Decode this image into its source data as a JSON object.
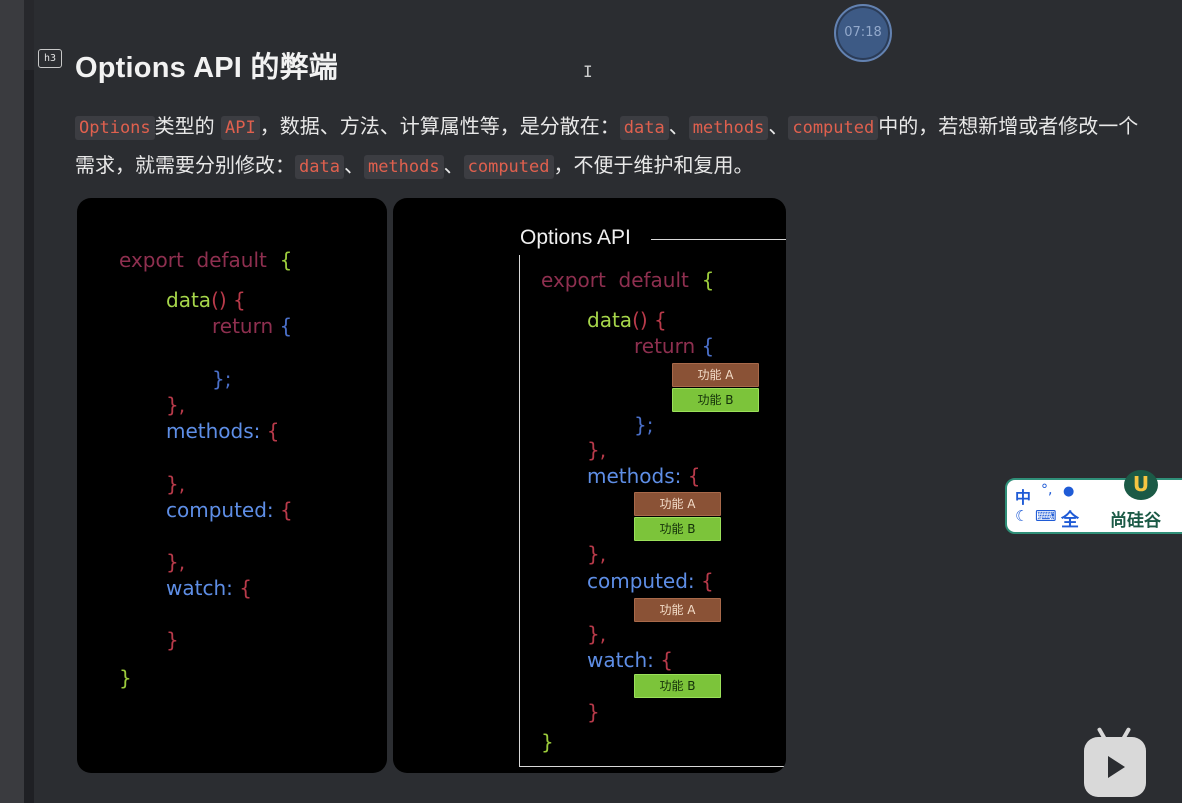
{
  "heading": {
    "badge": "h3",
    "title": "Options API 的弊端"
  },
  "timer": "07:18",
  "paragraph": {
    "chip_options": "Options",
    "t1": "类型的",
    "chip_api": "API",
    "t2": "，数据、方法、计算属性等，是分散在：",
    "chip_data1": "data",
    "sep1": "、",
    "chip_methods1": "methods",
    "sep2": "、",
    "chip_computed1": "computed",
    "t3": "中的，若想新增或者修改一个需求，就需要分别修改：",
    "chip_data2": "data",
    "sep3": "、",
    "chip_methods2": "methods",
    "sep4": "、",
    "chip_computed2": "computed",
    "t4": "，不便于维护和复用。"
  },
  "left_code": {
    "export_default": "export  default",
    "open_brace": "{",
    "data_fn": "data",
    "parens": "()",
    "brace_open": "{",
    "return_kw": "return",
    "return_brace": "{",
    "return_close": "};",
    "close_comma": "},",
    "methods": "methods:",
    "computed": "computed:",
    "watch": "watch:",
    "close_brace": "}",
    "final_brace": "}"
  },
  "right_code": {
    "section_title": "Options API",
    "export_default": "export  default",
    "open_brace": "{",
    "data_fn": "data",
    "parens": "()",
    "brace_open": "{",
    "return_kw": "return",
    "return_brace": "{",
    "return_close": "};",
    "close_comma": "},",
    "methods": "methods:",
    "computed": "computed:",
    "watch": "watch:",
    "close_brace": "}",
    "final_brace": "}",
    "feature_a": "功能 A",
    "feature_b": "功能 B"
  },
  "ime": {
    "lang": "中",
    "punct": "°,",
    "width_mode": "全",
    "brand_letter": "U",
    "brand_name": "尚硅谷"
  },
  "colors": {
    "background": "#2b2d31",
    "code_chip": "#e0604e",
    "feature_a": "#8a5236",
    "feature_b": "#7cc43a",
    "keyword": "#8e2f4f",
    "property": "#5e8ee6"
  }
}
